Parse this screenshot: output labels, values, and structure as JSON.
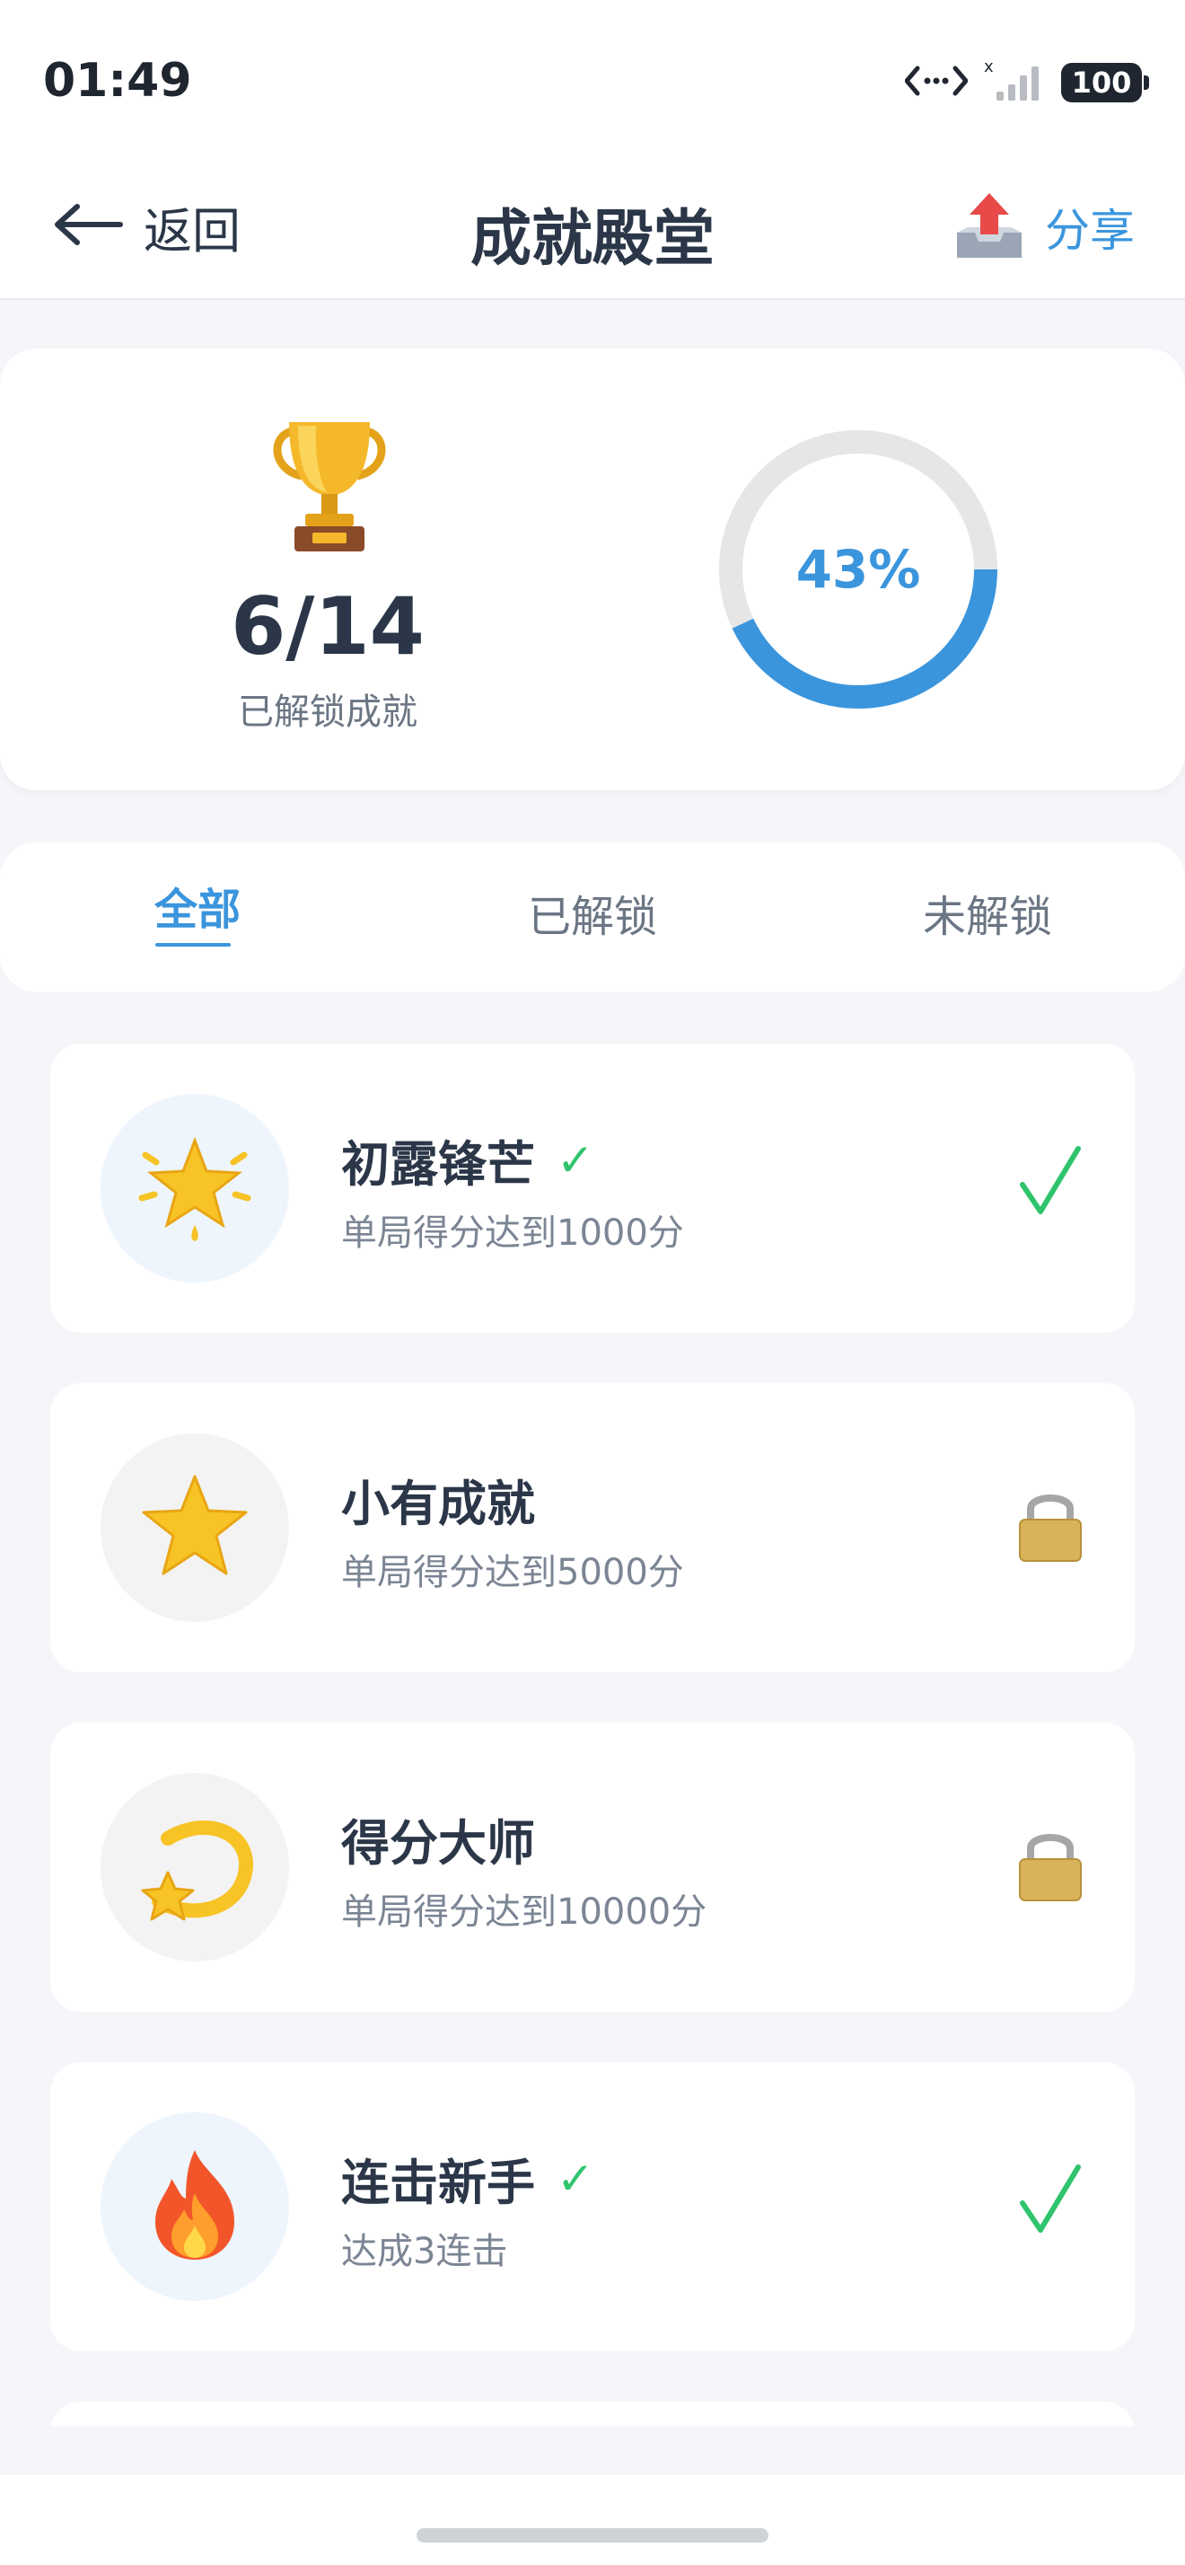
{
  "status_bar": {
    "time": "01:49",
    "battery": "100"
  },
  "nav": {
    "back_label": "返回",
    "title": "成就殿堂",
    "share_label": "分享"
  },
  "summary": {
    "count": "6/14",
    "count_label": "已解锁成就",
    "progress_text": "43%",
    "progress_fraction": 0.43
  },
  "tabs": [
    {
      "label": "全部",
      "active": true
    },
    {
      "label": "已解锁",
      "active": false
    },
    {
      "label": "未解锁",
      "active": false
    }
  ],
  "achievements": [
    {
      "title": "初露锋芒",
      "desc": "单局得分达到1000分",
      "unlocked": true,
      "icon": "glowing-star-icon",
      "check_mark": "✓"
    },
    {
      "title": "小有成就",
      "desc": "单局得分达到5000分",
      "unlocked": false,
      "icon": "star-icon"
    },
    {
      "title": "得分大师",
      "desc": "单局得分达到10000分",
      "unlocked": false,
      "icon": "shooting-star-icon"
    },
    {
      "title": "连击新手",
      "desc": "达成3连击",
      "unlocked": true,
      "icon": "fire-icon",
      "check_mark": "✓"
    }
  ],
  "colors": {
    "accent": "#3a95dd",
    "success": "#2fc46c",
    "ring_track": "#e6e6e6"
  }
}
